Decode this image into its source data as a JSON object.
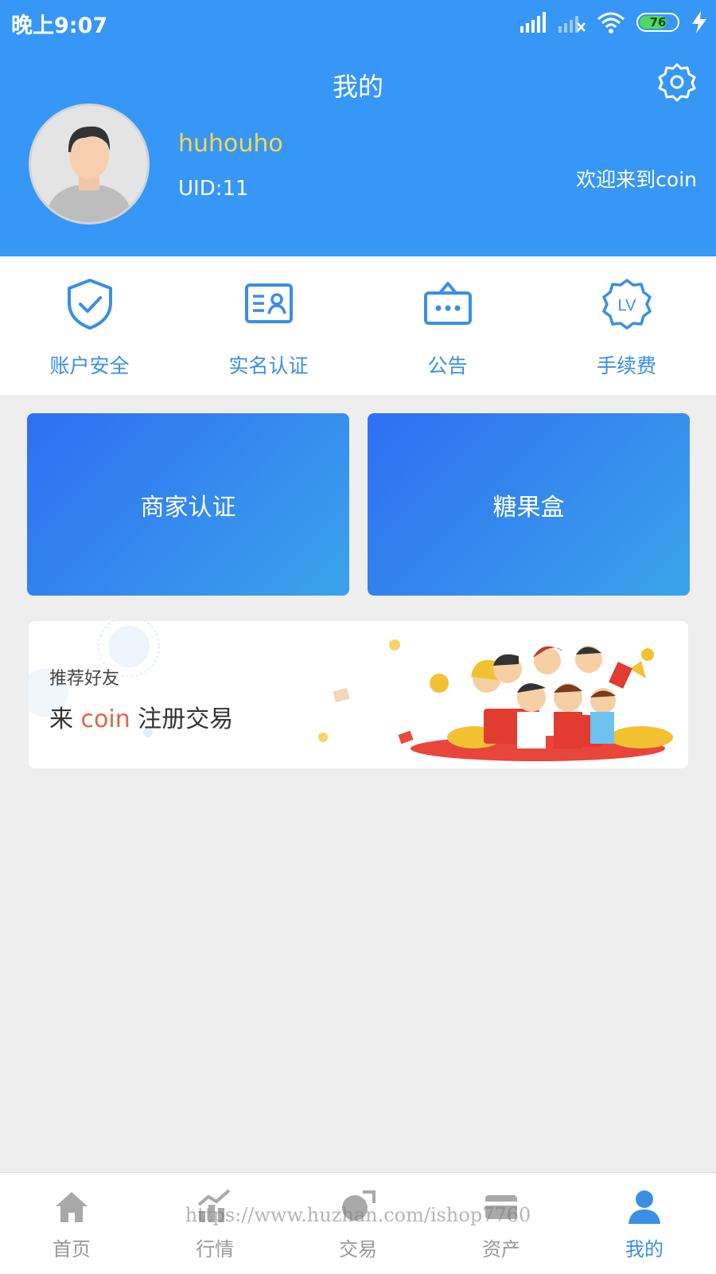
{
  "status_bar": {
    "time": "晚上9:07",
    "battery": "76"
  },
  "header": {
    "title": "我的",
    "username": "huhouho",
    "uid": "UID:11",
    "welcome": "欢迎来到coin"
  },
  "quick_menu": [
    {
      "label": "账户安全",
      "icon": "shield-check-icon"
    },
    {
      "label": "实名认证",
      "icon": "id-card-icon"
    },
    {
      "label": "公告",
      "icon": "notice-board-icon"
    },
    {
      "label": "手续费",
      "icon": "lv-badge-icon"
    }
  ],
  "cards": {
    "merchant": "商家认证",
    "candy": "糖果盒"
  },
  "promo": {
    "subtitle": "推荐好友",
    "title_prefix": "来",
    "title_highlight": "coin",
    "title_suffix": "注册交易"
  },
  "tabs": [
    {
      "label": "首页",
      "icon": "home-icon",
      "active": false
    },
    {
      "label": "行情",
      "icon": "chart-icon",
      "active": false
    },
    {
      "label": "交易",
      "icon": "trade-icon",
      "active": false
    },
    {
      "label": "资产",
      "icon": "wallet-icon",
      "active": false
    },
    {
      "label": "我的",
      "icon": "user-icon",
      "active": true
    }
  ],
  "watermark": "https://www.huzhan.com/ishop7760",
  "colors": {
    "primary": "#3797f6",
    "accent_text": "#3a8ee6",
    "username": "#f8d84a",
    "highlight": "#e8623e"
  }
}
